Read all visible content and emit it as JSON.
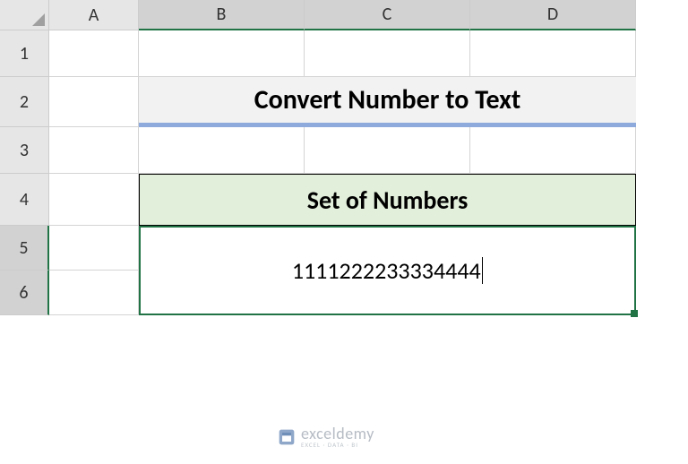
{
  "columns": [
    {
      "label": "A",
      "width": 100,
      "selected": false
    },
    {
      "label": "B",
      "width": 185,
      "selected": true
    },
    {
      "label": "C",
      "width": 185,
      "selected": true
    },
    {
      "label": "D",
      "width": 185,
      "selected": true
    }
  ],
  "rows": [
    {
      "label": "1",
      "height": 52,
      "selected": false
    },
    {
      "label": "2",
      "height": 56,
      "selected": false
    },
    {
      "label": "3",
      "height": 52,
      "selected": false
    },
    {
      "label": "4",
      "height": 58,
      "selected": false
    },
    {
      "label": "5",
      "height": 50,
      "selected": true
    },
    {
      "label": "6",
      "height": 50,
      "selected": true
    }
  ],
  "title": {
    "text": "Convert Number to Text"
  },
  "set_header": {
    "text": "Set of Numbers"
  },
  "editing": {
    "value": "1111222233334444"
  },
  "watermark": {
    "brand": "exceldemy",
    "tagline": "EXCEL · DATA · BI"
  },
  "colors": {
    "accent": "#217346",
    "title_underline": "#8ea9db",
    "set_bg": "#e2efda",
    "title_bg": "#f2f2f2"
  }
}
